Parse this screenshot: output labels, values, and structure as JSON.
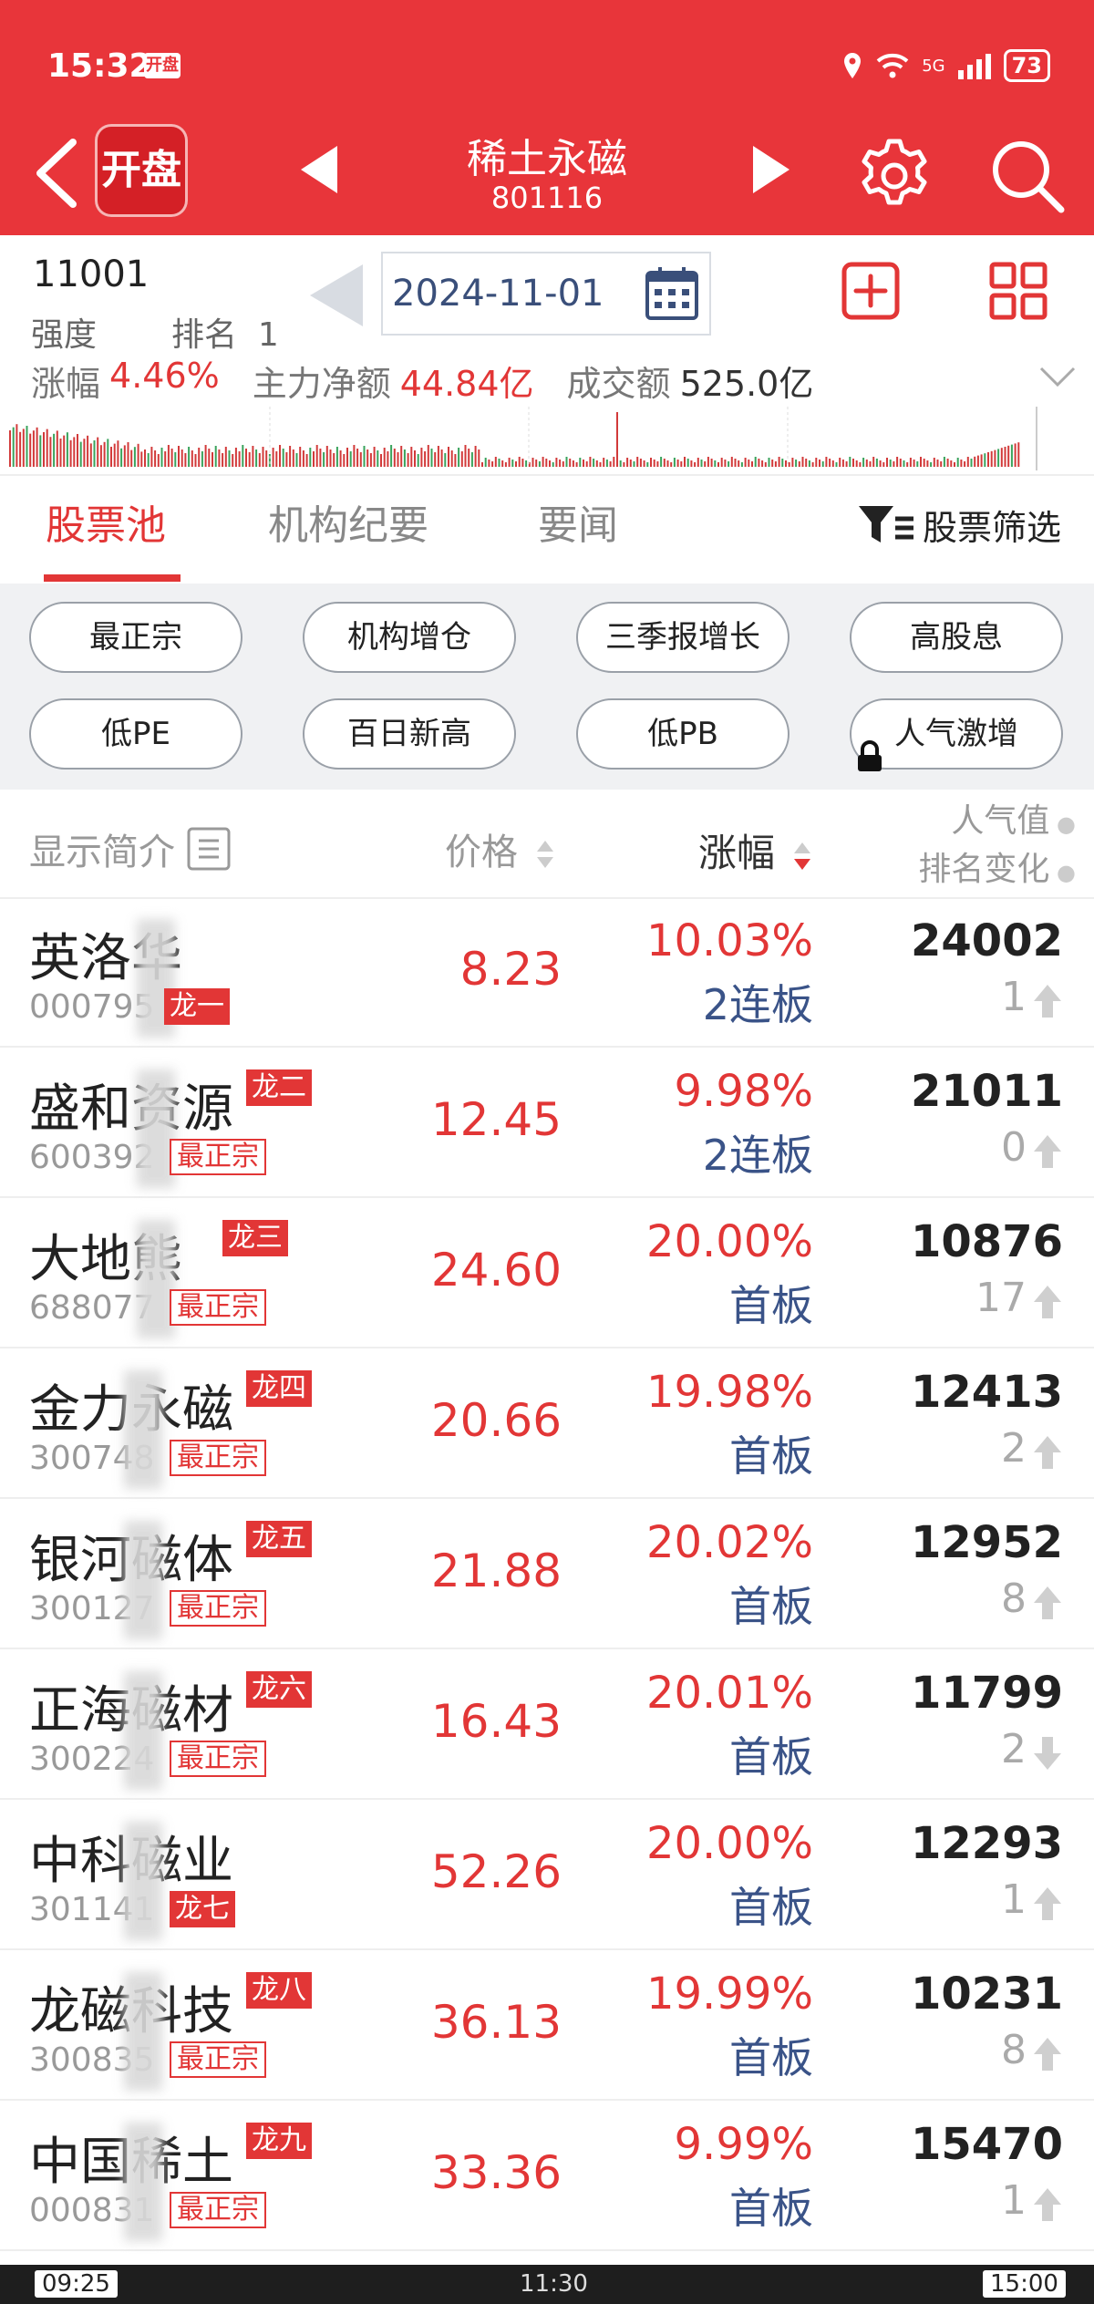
{
  "status": {
    "time": "15:32",
    "app_badge": "开盘",
    "network": "5G",
    "battery": "73"
  },
  "header": {
    "logo": "开盘",
    "sector_name": "稀土永磁",
    "sector_code": "801116"
  },
  "info": {
    "code": "11001",
    "strength_label": "强度",
    "rank_label": "排名",
    "rank_value": "1",
    "date": "2024-11-01",
    "change_label": "涨幅",
    "change_value": "4.46%",
    "net_flow_label": "主力净额",
    "net_flow_value": "44.84亿",
    "turnover_label": "成交额",
    "turnover_value": "525.0亿"
  },
  "tabs": [
    {
      "label": "股票池",
      "active": true
    },
    {
      "label": "机构纪要",
      "active": false
    },
    {
      "label": "要闻",
      "active": false
    }
  ],
  "filter_label": "股票筛选",
  "chips": [
    "最正宗",
    "机构增仓",
    "三季报增长",
    "高股息",
    "低PE",
    "百日新高",
    "低PB",
    "人气激增"
  ],
  "list_header": {
    "show": "显示简介",
    "price": "价格",
    "change": "涨幅",
    "pop_line1": "人气值",
    "pop_line2": "排名变化"
  },
  "colors": {
    "brand_red": "#e8353a",
    "up_red": "#e23636",
    "board_blue": "#3a5388"
  },
  "rows": [
    {
      "name": "英洛华",
      "code": "000795",
      "tags": [
        "龙一"
      ],
      "price": "8.23",
      "change": "10.03%",
      "board": "2连板",
      "pop": "24002",
      "rank_change": "1",
      "rank_dir": "up"
    },
    {
      "name": "盛和资源",
      "code": "600392",
      "tags": [
        "龙二",
        "最正宗"
      ],
      "price": "12.45",
      "change": "9.98%",
      "board": "2连板",
      "pop": "21011",
      "rank_change": "0",
      "rank_dir": "up"
    },
    {
      "name": "大地熊",
      "code": "688077",
      "tags": [
        "龙三",
        "最正宗"
      ],
      "price": "24.60",
      "change": "20.00%",
      "board": "首板",
      "pop": "10876",
      "rank_change": "17",
      "rank_dir": "up"
    },
    {
      "name": "金力永磁",
      "code": "300748",
      "tags": [
        "龙四",
        "最正宗"
      ],
      "price": "20.66",
      "change": "19.98%",
      "board": "首板",
      "pop": "12413",
      "rank_change": "2",
      "rank_dir": "up"
    },
    {
      "name": "银河磁体",
      "code": "300127",
      "tags": [
        "龙五",
        "最正宗"
      ],
      "price": "21.88",
      "change": "20.02%",
      "board": "首板",
      "pop": "12952",
      "rank_change": "8",
      "rank_dir": "up"
    },
    {
      "name": "正海磁材",
      "code": "300224",
      "tags": [
        "龙六",
        "最正宗"
      ],
      "price": "16.43",
      "change": "20.01%",
      "board": "首板",
      "pop": "11799",
      "rank_change": "2",
      "rank_dir": "down"
    },
    {
      "name": "中科磁业",
      "code": "301141",
      "tags": [
        "龙七"
      ],
      "price": "52.26",
      "change": "20.00%",
      "board": "首板",
      "pop": "12293",
      "rank_change": "1",
      "rank_dir": "up"
    },
    {
      "name": "龙磁科技",
      "code": "300835",
      "tags": [
        "龙八",
        "最正宗"
      ],
      "price": "36.13",
      "change": "19.99%",
      "board": "首板",
      "pop": "10231",
      "rank_change": "8",
      "rank_dir": "up"
    },
    {
      "name": "中国稀土",
      "code": "000831",
      "tags": [
        "龙九",
        "最正宗"
      ],
      "price": "33.36",
      "change": "9.99%",
      "board": "首板",
      "pop": "15470",
      "rank_change": "1",
      "rank_dir": "up"
    }
  ],
  "timeline": [
    "09:25",
    "11:30",
    "15:00"
  ]
}
